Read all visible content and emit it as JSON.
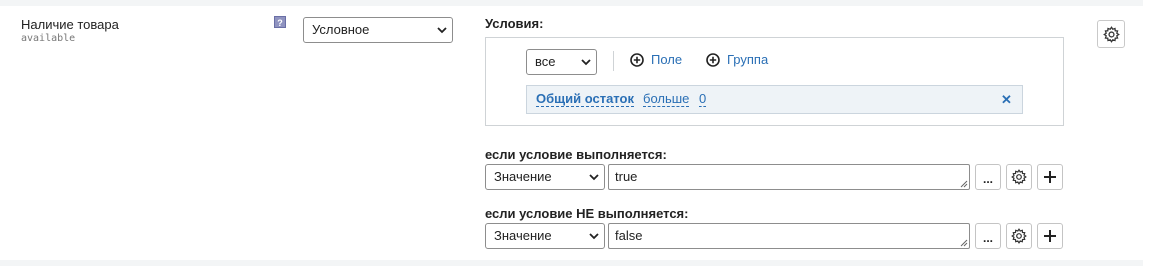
{
  "field": {
    "label": "Наличие товара",
    "code": "available",
    "help_icon": "question-icon",
    "type_select": "Условное"
  },
  "conditions": {
    "title": "Условия:",
    "logic_select": "все",
    "add_field_label": "Поле",
    "add_group_label": "Группа",
    "rule": {
      "field": "Общий остаток",
      "operator": "больше",
      "value": "0",
      "remove_icon": "close-icon"
    }
  },
  "if_true": {
    "label": "если условие выполняется:",
    "type_select": "Значение",
    "value": "true",
    "more_label": "..."
  },
  "if_false": {
    "label": "если условие НЕ выполняется:",
    "type_select": "Значение",
    "value": "false",
    "more_label": "..."
  },
  "colors": {
    "link": "#2a6fb5",
    "rule_bg": "#eef3f7",
    "band": "#f3f5f6"
  }
}
